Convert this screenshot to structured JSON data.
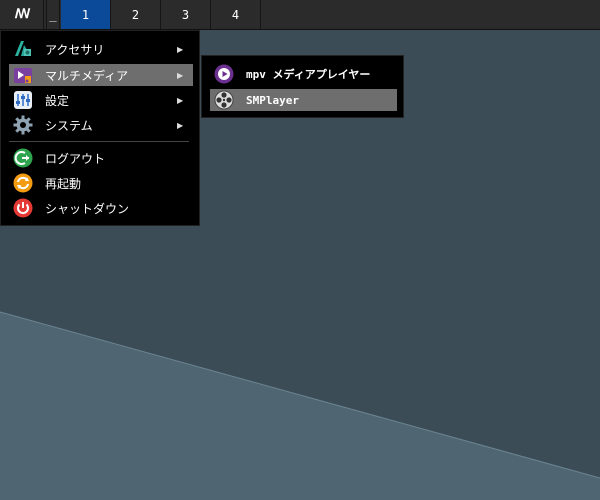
{
  "taskbar": {
    "logo": "ꟿ",
    "minimize": "_",
    "workspaces": [
      "1",
      "2",
      "3",
      "4"
    ],
    "active_workspace": "1",
    "active_color": "#0b4a99"
  },
  "main_menu": {
    "items": [
      {
        "label": "アクセサリ",
        "icon": "accessories-icon",
        "submenu": true
      },
      {
        "label": "マルチメディア",
        "icon": "multimedia-icon",
        "submenu": true,
        "highlighted": true
      },
      {
        "label": "設定",
        "icon": "settings-icon",
        "submenu": true
      },
      {
        "label": "システム",
        "icon": "system-gear-icon",
        "submenu": true
      },
      {
        "label": "ログアウト",
        "icon": "logout-icon",
        "submenu": false
      },
      {
        "label": "再起動",
        "icon": "restart-icon",
        "submenu": false
      },
      {
        "label": "シャットダウン",
        "icon": "shutdown-icon",
        "submenu": false
      }
    ],
    "arrow": "▶"
  },
  "sub_menu": {
    "items": [
      {
        "label": "mpv メディアプレイヤー",
        "icon": "mpv-icon"
      },
      {
        "label": "SMPlayer",
        "icon": "smplayer-icon",
        "highlighted": true
      }
    ]
  },
  "colors": {
    "highlight": "#6e6e6e",
    "desktop_dark": "#3a4a55",
    "desktop_light": "#4e6470"
  }
}
